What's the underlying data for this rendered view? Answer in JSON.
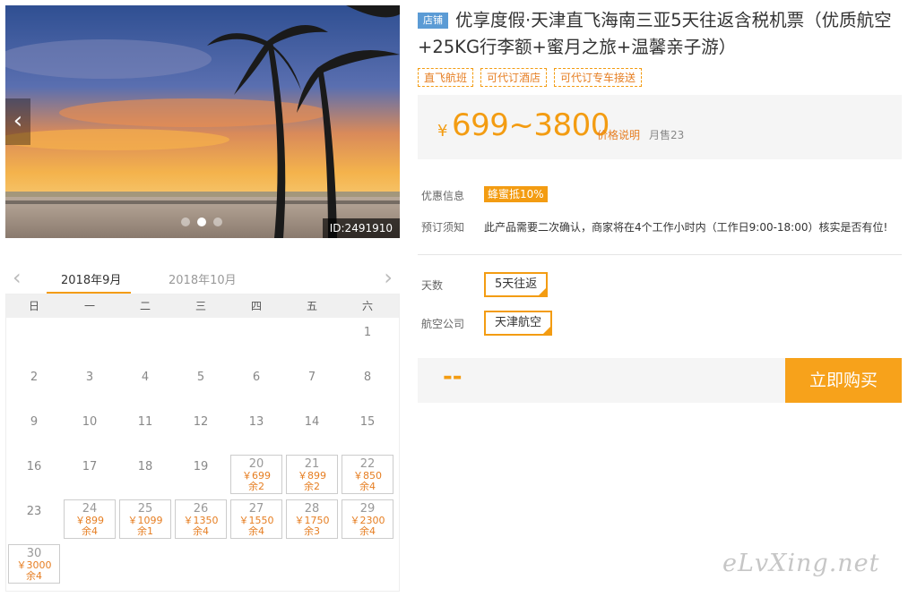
{
  "gallery": {
    "id_label": "ID:2491910",
    "slide_count": 3,
    "active_slide": 2
  },
  "calendar": {
    "months": [
      "2018年9月",
      "2018年10月"
    ],
    "weekdays": [
      "日",
      "一",
      "二",
      "三",
      "四",
      "五",
      "六"
    ],
    "days": [
      {
        "d": "",
        "price": "",
        "rem": ""
      },
      {
        "d": "",
        "price": "",
        "rem": ""
      },
      {
        "d": "",
        "price": "",
        "rem": ""
      },
      {
        "d": "",
        "price": "",
        "rem": ""
      },
      {
        "d": "",
        "price": "",
        "rem": ""
      },
      {
        "d": "",
        "price": "",
        "rem": ""
      },
      {
        "d": "1",
        "price": "",
        "rem": ""
      },
      {
        "d": "2",
        "price": "",
        "rem": ""
      },
      {
        "d": "3",
        "price": "",
        "rem": ""
      },
      {
        "d": "4",
        "price": "",
        "rem": ""
      },
      {
        "d": "5",
        "price": "",
        "rem": ""
      },
      {
        "d": "6",
        "price": "",
        "rem": ""
      },
      {
        "d": "7",
        "price": "",
        "rem": ""
      },
      {
        "d": "8",
        "price": "",
        "rem": ""
      },
      {
        "d": "9",
        "price": "",
        "rem": ""
      },
      {
        "d": "10",
        "price": "",
        "rem": ""
      },
      {
        "d": "11",
        "price": "",
        "rem": ""
      },
      {
        "d": "12",
        "price": "",
        "rem": ""
      },
      {
        "d": "13",
        "price": "",
        "rem": ""
      },
      {
        "d": "14",
        "price": "",
        "rem": ""
      },
      {
        "d": "15",
        "price": "",
        "rem": ""
      },
      {
        "d": "16",
        "price": "",
        "rem": ""
      },
      {
        "d": "17",
        "price": "",
        "rem": ""
      },
      {
        "d": "18",
        "price": "",
        "rem": ""
      },
      {
        "d": "19",
        "price": "",
        "rem": ""
      },
      {
        "d": "20",
        "price": "￥699",
        "rem": "余2"
      },
      {
        "d": "21",
        "price": "￥899",
        "rem": "余2"
      },
      {
        "d": "22",
        "price": "￥850",
        "rem": "余4"
      },
      {
        "d": "23",
        "price": "",
        "rem": ""
      },
      {
        "d": "24",
        "price": "￥899",
        "rem": "余4"
      },
      {
        "d": "25",
        "price": "￥1099",
        "rem": "余1"
      },
      {
        "d": "26",
        "price": "￥1350",
        "rem": "余4"
      },
      {
        "d": "27",
        "price": "￥1550",
        "rem": "余4"
      },
      {
        "d": "28",
        "price": "￥1750",
        "rem": "余3"
      },
      {
        "d": "29",
        "price": "￥2300",
        "rem": "余4"
      },
      {
        "d": "30",
        "price": "￥3000",
        "rem": "余4"
      }
    ]
  },
  "product": {
    "shop_badge": "店铺",
    "title": "优享度假·天津直飞海南三亚5天往返含税机票（优质航空+25KG行李额+蜜月之旅+温馨亲子游）",
    "tags": [
      "直飞航班",
      "可代订酒店",
      "可代订专车接送"
    ],
    "price_symbol": "¥",
    "price": "699~3800",
    "price_note": "价格说明",
    "sold": "月售23"
  },
  "info": {
    "discount_label": "优惠信息",
    "discount_value": "蜂蜜抵10%",
    "notice_label": "预订须知",
    "notice_value": "此产品需要二次确认，商家将在4个工作小时内（工作日9:00-18:00）核实是否有位!"
  },
  "options": {
    "days_label": "天数",
    "days_value": "5天往返",
    "airline_label": "航空公司",
    "airline_value": "天津航空"
  },
  "buy": {
    "placeholder": "--",
    "button": "立即购买"
  },
  "watermark": "eLvXing.net",
  "colors": {
    "accent": "#f39c12",
    "badge": "#5b9bd5"
  }
}
